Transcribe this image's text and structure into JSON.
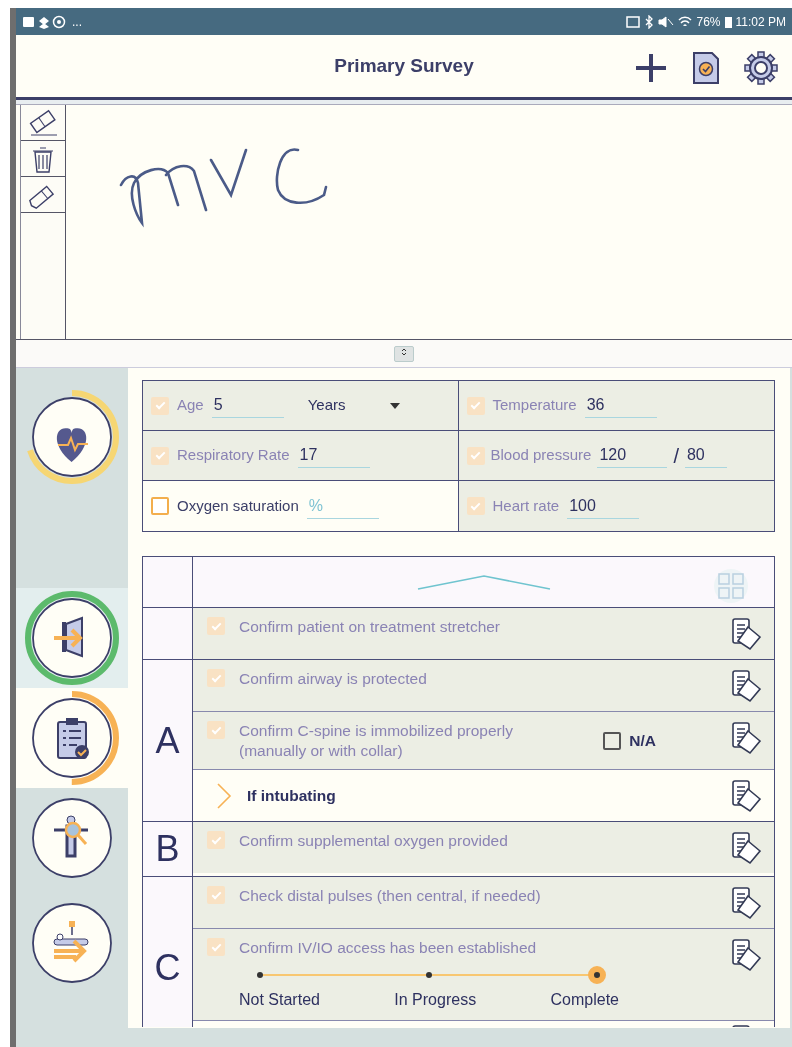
{
  "status_bar": {
    "overflow": "...",
    "battery": "76%",
    "time": "11:02 PM"
  },
  "header": {
    "title": "Primary Survey"
  },
  "sidebar": {
    "items": [
      {
        "kind": "vitals",
        "color": "#f6d673",
        "selected": false
      },
      {
        "kind": "entry",
        "color": "#5cba6c",
        "selected": false
      },
      {
        "kind": "clipboard",
        "color": "#f7b255",
        "selected": true
      },
      {
        "kind": "exam",
        "selected": false
      },
      {
        "kind": "transfer",
        "selected": false
      }
    ]
  },
  "vitals": [
    {
      "kind": "select",
      "label": "Age",
      "checked": true,
      "value": "5",
      "unit": "Years"
    },
    {
      "kind": "text",
      "label": "Temperature",
      "checked": true,
      "value": "36"
    },
    {
      "kind": "text",
      "label": "Respiratory Rate",
      "checked": true,
      "value": "17"
    },
    {
      "kind": "pair",
      "label": "Blood pressure",
      "checked": true,
      "value": "120",
      "separator": "/",
      "value2": "80"
    },
    {
      "kind": "text",
      "label": "Oxygen saturation",
      "checked": false,
      "placeholder": "%"
    },
    {
      "kind": "text",
      "label": "Heart rate",
      "checked": true,
      "value": "100"
    }
  ],
  "checklist": {
    "groups": [
      {
        "items": [
          {
            "kind": "check",
            "text": "Confirm patient on treatment stretcher",
            "checked": true
          }
        ]
      },
      {
        "letter": "A",
        "items": [
          {
            "kind": "check",
            "text": "Confirm airway is protected",
            "checked": true
          },
          {
            "kind": "check",
            "text": "Confirm C-spine is immobilized properly",
            "subtext": "(manually or with collar)",
            "checked": true,
            "na": {
              "label": "N/A",
              "checked": false
            }
          },
          {
            "kind": "expander",
            "text": "If intubating",
            "expanded": false
          }
        ]
      },
      {
        "letter": "B",
        "items": [
          {
            "kind": "check",
            "text": "Confirm supplemental oxygen provided",
            "checked": true
          }
        ]
      },
      {
        "letter": "C",
        "items": [
          {
            "kind": "check",
            "text": "Check distal pulses (then central, if needed)",
            "checked": true
          },
          {
            "kind": "progress",
            "text": "Confirm IV/IO access has been established",
            "checked": true,
            "steps": [
              {
                "label": "Not Started",
                "selected": false
              },
              {
                "label": "In Progress",
                "selected": false
              },
              {
                "label": "Complete",
                "selected": true
              }
            ]
          },
          {
            "kind": "blank"
          }
        ]
      }
    ]
  }
}
